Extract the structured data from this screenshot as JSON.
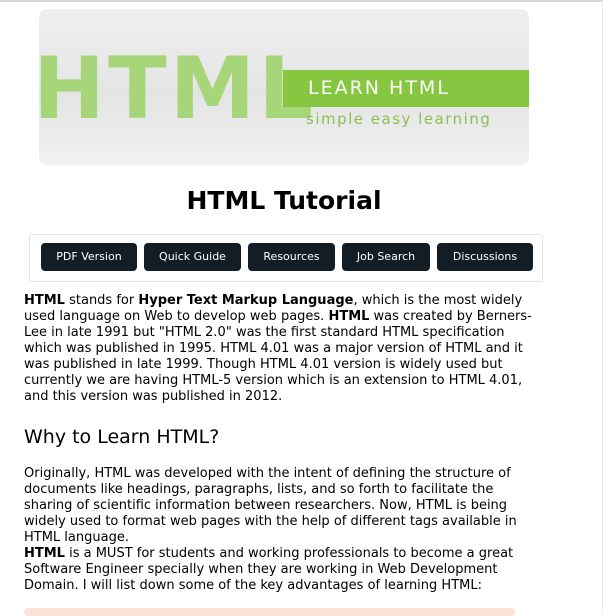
{
  "banner": {
    "big_text": "HTML",
    "learn_text": "LEARN HTML",
    "tagline": "simple easy learning"
  },
  "title": "HTML Tutorial",
  "buttons": [
    {
      "label": "PDF Version"
    },
    {
      "label": "Quick Guide"
    },
    {
      "label": "Resources"
    },
    {
      "label": "Job Search"
    },
    {
      "label": "Discussions"
    }
  ],
  "intro": {
    "b1": "HTML",
    "t1": " stands for ",
    "b2": "Hyper Text Markup Language",
    "t2": ", which is the most widely used language on Web to develop web pages. ",
    "b3": "HTML",
    "t3": " was created by Berners-Lee in late 1991 but \"HTML 2.0\" was the first standard HTML specification which was published in 1995. HTML 4.01 was a major version of HTML and it was published in late 1999. Though HTML 4.01 version is widely used but currently we are having HTML-5 version which is an extension to HTML 4.01, and this version was published in 2012."
  },
  "why_heading": "Why to Learn HTML?",
  "why_paragraph": "Originally, HTML was developed with the intent of defining the structure of documents like headings, paragraphs, lists, and so forth to facilitate the sharing of scientific information between researchers. Now, HTML is being widely used to format web pages with the help of different tags available in HTML language.",
  "must": {
    "b1": "HTML",
    "t1": " is a MUST for students and working professionals to become a great Software Engineer specially when they are working in Web Development Domain. I will list down some of the key advantages of learning HTML:"
  },
  "colors": {
    "button_bg": "#131d26",
    "banner_green": "#86c641",
    "banner_light_green": "#a7d57a",
    "callout_bg": "#fbe4d5"
  }
}
